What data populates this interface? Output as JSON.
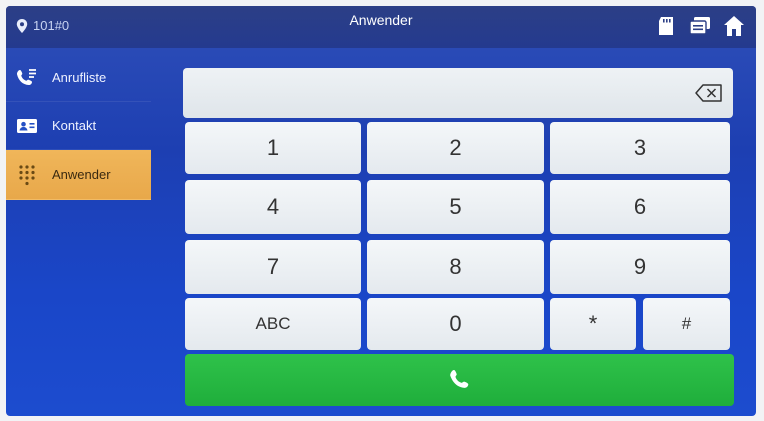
{
  "header": {
    "room": "101#0",
    "title": "Anwender"
  },
  "sidebar": {
    "items": [
      {
        "label": "Anrufliste",
        "icon": "call-log-icon"
      },
      {
        "label": "Kontakt",
        "icon": "contact-card-icon"
      },
      {
        "label": "Anwender",
        "icon": "dialpad-icon",
        "active": true
      }
    ]
  },
  "dialer": {
    "number": "",
    "keys": [
      "1",
      "2",
      "3",
      "4",
      "5",
      "6",
      "7",
      "8",
      "9",
      "ABC",
      "0",
      "*",
      "#"
    ]
  },
  "colors": {
    "accent_active": "#e8a84a",
    "call_green": "#22b33f",
    "background_blue": "#1d3fb2"
  }
}
